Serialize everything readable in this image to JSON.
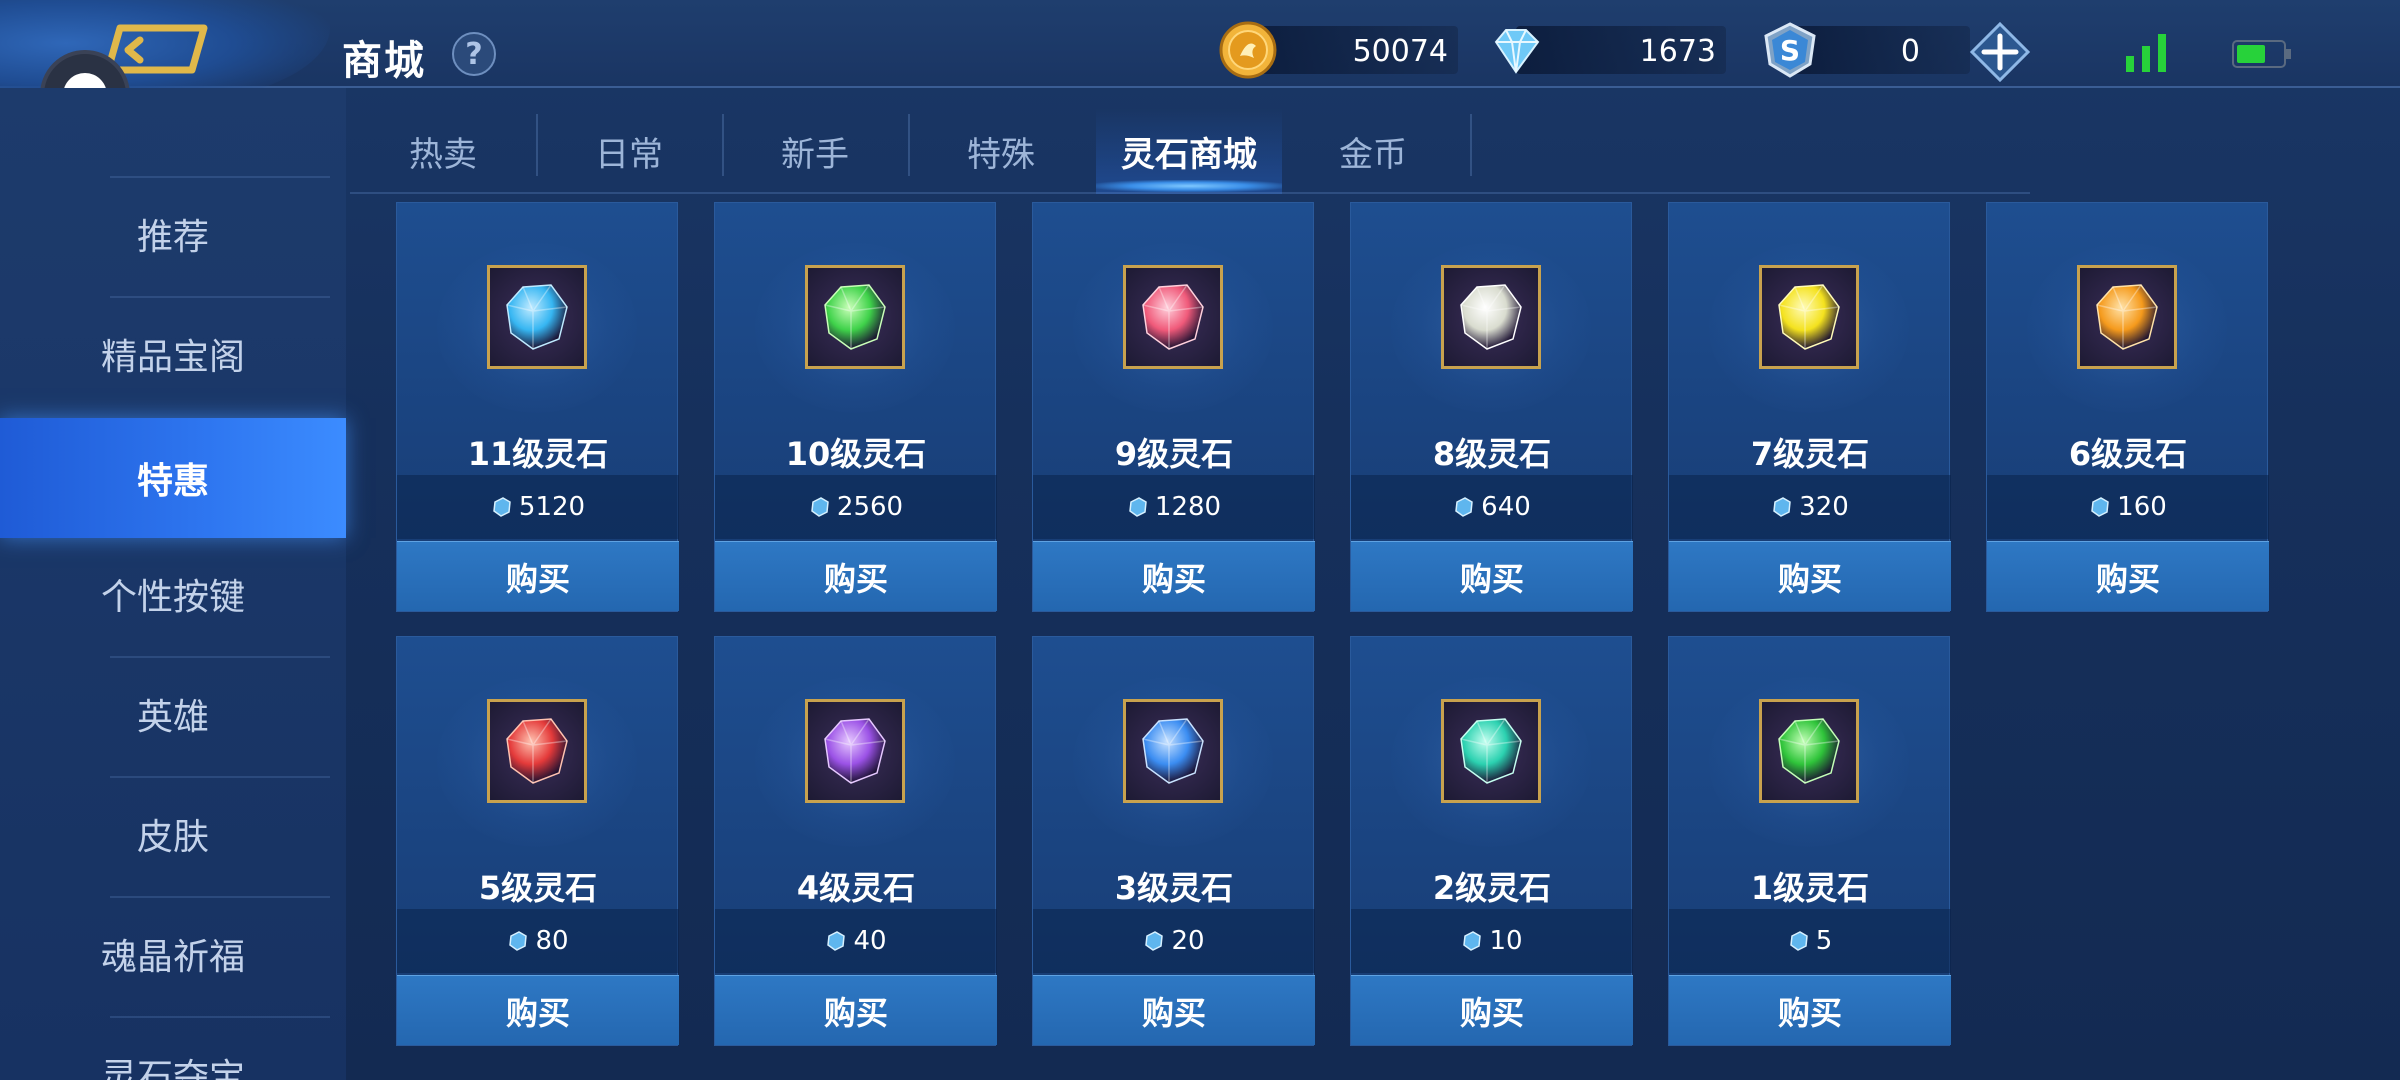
{
  "header": {
    "title": "商城",
    "help_glyph": "?",
    "currencies": [
      {
        "name": "gold-coin-icon",
        "value": "50074"
      },
      {
        "name": "diamond-icon",
        "value": "1673"
      },
      {
        "name": "spirit-coin-icon",
        "value": "0"
      }
    ]
  },
  "sidebar": {
    "items": [
      {
        "label": "推荐",
        "active": false
      },
      {
        "label": "精品宝阁",
        "active": false
      },
      {
        "label": "特惠",
        "active": true
      },
      {
        "label": "个性按键",
        "active": false
      },
      {
        "label": "英雄",
        "active": false
      },
      {
        "label": "皮肤",
        "active": false
      },
      {
        "label": "魂晶祈福",
        "active": false
      },
      {
        "label": "灵石夺宝",
        "active": false
      }
    ]
  },
  "tabs": [
    {
      "label": "热卖",
      "active": false
    },
    {
      "label": "日常",
      "active": false
    },
    {
      "label": "新手",
      "active": false
    },
    {
      "label": "特殊",
      "active": false
    },
    {
      "label": "灵石商城",
      "active": true
    },
    {
      "label": "金币",
      "active": false
    }
  ],
  "products": [
    {
      "name": "11级灵石",
      "price": "5120",
      "buy": "购买",
      "gem_color": "#36b6f2",
      "gem_light": "#bfeaff"
    },
    {
      "name": "10级灵石",
      "price": "2560",
      "buy": "购买",
      "gem_color": "#3fd24a",
      "gem_light": "#c9ffb8"
    },
    {
      "name": "9级灵石",
      "price": "1280",
      "buy": "购买",
      "gem_color": "#f05a7a",
      "gem_light": "#ffd0dc"
    },
    {
      "name": "8级灵石",
      "price": "640",
      "buy": "购买",
      "gem_color": "#d9dccf",
      "gem_light": "#ffffff"
    },
    {
      "name": "7级灵石",
      "price": "320",
      "buy": "购买",
      "gem_color": "#f4e21e",
      "gem_light": "#fffbb8"
    },
    {
      "name": "6级灵石",
      "price": "160",
      "buy": "购买",
      "gem_color": "#f59a1c",
      "gem_light": "#ffe2a8"
    },
    {
      "name": "5级灵石",
      "price": "80",
      "buy": "购买",
      "gem_color": "#e43a3a",
      "gem_light": "#ffc2b0"
    },
    {
      "name": "4级灵石",
      "price": "40",
      "buy": "购买",
      "gem_color": "#9b52e6",
      "gem_light": "#e6c8ff"
    },
    {
      "name": "3级灵石",
      "price": "20",
      "buy": "购买",
      "gem_color": "#3b8df2",
      "gem_light": "#c8e2ff"
    },
    {
      "name": "2级灵石",
      "price": "10",
      "buy": "购买",
      "gem_color": "#2bd1b0",
      "gem_light": "#c4fff0"
    },
    {
      "name": "1级灵石",
      "price": "5",
      "buy": "购买",
      "gem_color": "#2fc43a",
      "gem_light": "#c2ffb6"
    }
  ],
  "colors": {
    "accent_blue": "#2e76f0",
    "card_bg": "#1e4e90",
    "frame_gold": "#c8a24e",
    "signal_green": "#27d23a"
  }
}
